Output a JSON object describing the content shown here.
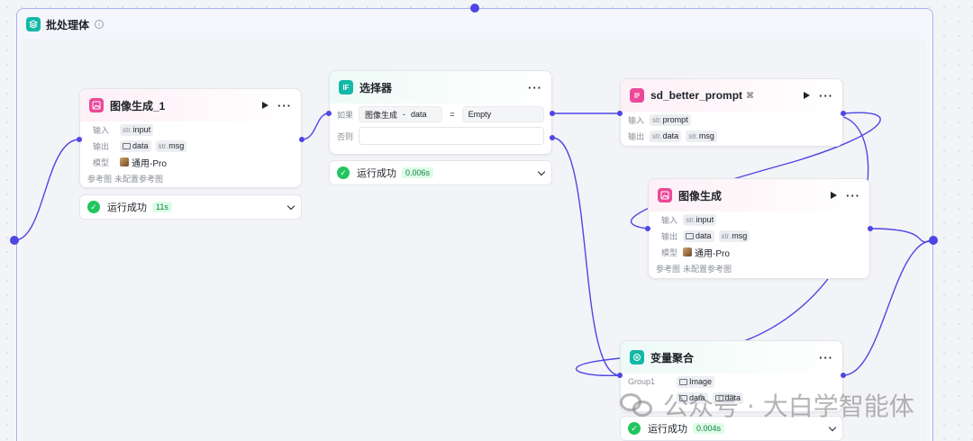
{
  "batch": {
    "title": "批处理体",
    "info": "i"
  },
  "node_image1": {
    "title": "图像生成_1",
    "input_label": "输入",
    "input_pre": "str.",
    "input_value": "input",
    "output_label": "输出",
    "output_values": [
      "data",
      "msg"
    ],
    "output_pre": "str.",
    "model_label": "模型",
    "model_value": "通用-Pro",
    "ref_label": "参考图",
    "ref_value": "未配置参考图",
    "status": "运行成功",
    "time": "11s"
  },
  "node_selector": {
    "title": "选择器",
    "icon": "IF",
    "if_label": "如果",
    "cond_left": "图像生成",
    "cond_sep": "-",
    "cond_var": "data",
    "cond_op": "=",
    "cond_right": "Empty",
    "else_label": "否则",
    "status": "运行成功",
    "time": "0.006s"
  },
  "node_sd": {
    "title": "sd_better_prompt",
    "input_label": "输入",
    "input_pre": "str.",
    "input_value": "prompt",
    "output_label": "输出",
    "output_pre": "str.",
    "output_values": [
      "data",
      "msg"
    ]
  },
  "node_image2": {
    "title": "图像生成",
    "input_label": "输入",
    "input_pre": "str.",
    "input_value": "input",
    "output_label": "输出",
    "output_values": [
      "data",
      "msg"
    ],
    "output_pre": "str.",
    "model_label": "模型",
    "model_value": "通用-Pro",
    "ref_label": "参考图",
    "ref_value": "未配置参考图"
  },
  "node_agg": {
    "title": "变量聚合",
    "group_label": "Group1",
    "group_type": "Image",
    "vars": [
      "data",
      "data"
    ],
    "status": "运行成功",
    "time": "0.004s"
  },
  "watermark": {
    "text": "公众号 · 大白学智能体"
  },
  "colors": {
    "accent": "#4f46e5",
    "success": "#22c55e",
    "pink": "#ec4899",
    "teal": "#14b8a6"
  }
}
